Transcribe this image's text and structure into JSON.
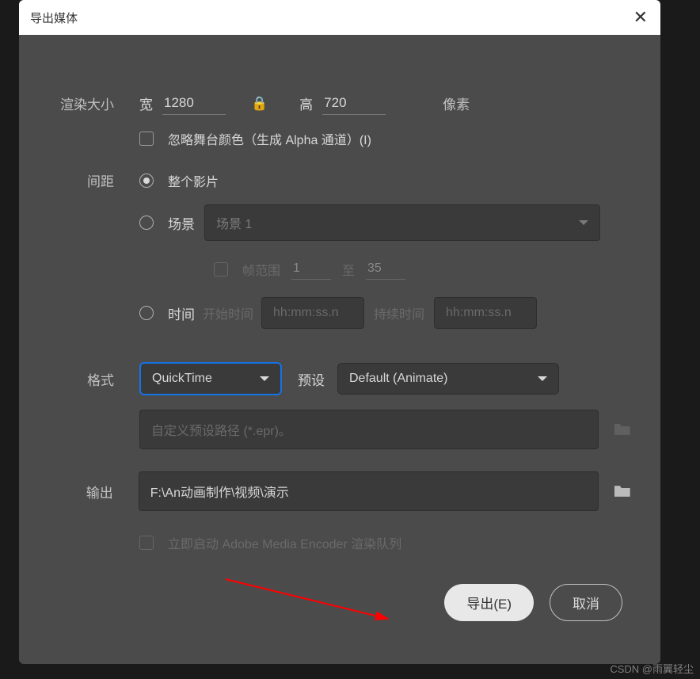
{
  "dialog": {
    "title": "导出媒体",
    "render_size": {
      "label": "渲染大小",
      "width_label": "宽",
      "width_value": "1280",
      "height_label": "高",
      "height_value": "720",
      "unit": "像素"
    },
    "ignore_stage": {
      "label": "忽略舞台颜色（生成 Alpha 通道）(I)"
    },
    "span": {
      "label": "间距",
      "options": {
        "entire": "整个影片",
        "scene": "场景",
        "scene_value": "场景 1",
        "frame_range": "帧范围",
        "frame_from": "1",
        "frame_to_label": "至",
        "frame_to": "35",
        "time": "时间",
        "start_time_label": "开始时间",
        "start_time_placeholder": "hh:mm:ss.n",
        "duration_label": "持续时间",
        "duration_placeholder": "hh:mm:ss.n"
      }
    },
    "format": {
      "label": "格式",
      "value": "QuickTime",
      "preset_label": "预设",
      "preset_value": "Default (Animate)"
    },
    "custom_preset": {
      "placeholder": "自定义预设路径 (*.epr)。"
    },
    "output": {
      "label": "输出",
      "path": "F:\\An动画制作\\视频\\演示"
    },
    "ame_queue": {
      "label": "立即启动 Adobe Media Encoder 渲染队列"
    },
    "buttons": {
      "export": "导出(E)",
      "cancel": "取消"
    }
  },
  "watermark": "CSDN @雨翼轻尘"
}
